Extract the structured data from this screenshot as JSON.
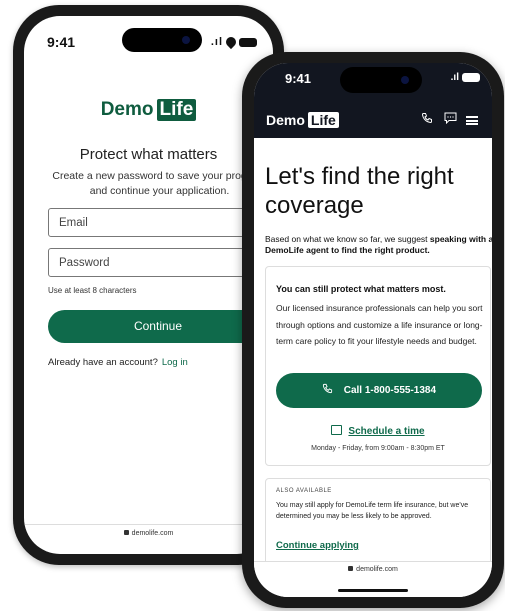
{
  "phone1": {
    "time": "9:41",
    "brand": {
      "word": "Demo",
      "box": "Life"
    },
    "heading": "Protect what matters",
    "subtext_line1": "Create a new password to save your progress",
    "subtext_line2": "and continue your application.",
    "email_placeholder": "Email",
    "password_placeholder": "Password",
    "password_hint": "Use at least 8 characters",
    "continue_label": "Continue",
    "account_prompt": "Already have an account?",
    "login_link": "Log in",
    "url": "demolife.com"
  },
  "phone2": {
    "time": "9:41",
    "brand": {
      "word": "Demo",
      "box": "Life"
    },
    "nav_icons": [
      "phone-icon",
      "chat-icon",
      "menu-icon"
    ],
    "heading_line1": "Let's find the right",
    "heading_line2": "coverage",
    "intro_plain": "Based on what we know so far, we suggest ",
    "intro_bold": "speaking with a DemoLife agent to find the right product.",
    "card_title": "You can still protect what matters most.",
    "card_body": "Our licensed insurance professionals can help you sort through options and customize a life insurance or long-term care policy to fit your lifestyle needs and budget.",
    "call_label": "Call 1-800-555-1384",
    "schedule_label": "Schedule a time",
    "hours": "Monday - Friday, from 9:00am - 8:30pm ET",
    "also_label": "ALSO AVAILABLE",
    "also_body": "You may still apply for DemoLife term life insurance, but we've determined you may be less likely to be approved.",
    "continue_link": "Continue applying",
    "url": "demolife.com"
  },
  "colors": {
    "brand_green": "#0f6a4b",
    "nav_dark": "#121620"
  }
}
